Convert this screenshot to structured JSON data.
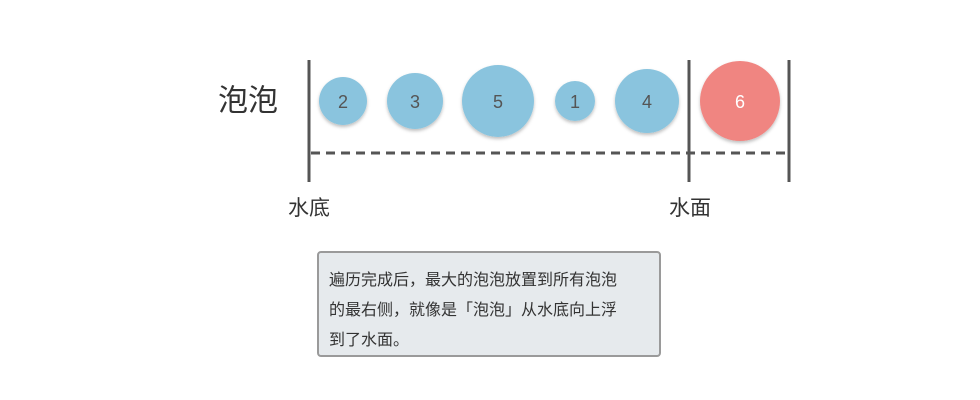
{
  "title_label": "泡泡",
  "bottom_label": "水底",
  "surface_label": "水面",
  "bubbles": [
    {
      "value": "2",
      "color": "#8ac4de"
    },
    {
      "value": "3",
      "color": "#8ac4de"
    },
    {
      "value": "5",
      "color": "#8ac4de"
    },
    {
      "value": "1",
      "color": "#8ac4de"
    },
    {
      "value": "4",
      "color": "#8ac4de"
    },
    {
      "value": "6",
      "color": "#f08581"
    }
  ],
  "caption": {
    "line1": "遍历完成后，最大的泡泡放置到所有泡泡",
    "line2": "的最右侧，就像是「泡泡」从水底向上浮",
    "line3": "到了水面。"
  },
  "colors": {
    "bubble_blue": "#8ac4de",
    "bubble_red": "#f08581",
    "line": "#555555",
    "number_dark": "#555555",
    "number_light": "#ffffff"
  }
}
